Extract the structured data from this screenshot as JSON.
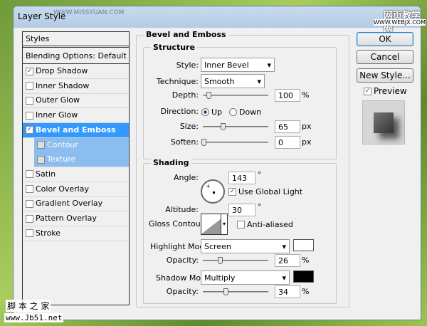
{
  "window": {
    "title": "Layer Style"
  },
  "watermarks": {
    "top_left": "WWW.MISSYUAN.COM",
    "top_right_1": "网页教学网",
    "top_right_2": "WWW.WEBJX.COM",
    "bottom_left_1": "脚 本 之 家",
    "bottom_left_2": "www.Jb51.net"
  },
  "sidebar": {
    "header": "Styles",
    "blending": "Blending Options: Default",
    "items": [
      {
        "label": "Drop Shadow",
        "checked": true
      },
      {
        "label": "Inner Shadow",
        "checked": false
      },
      {
        "label": "Outer Glow",
        "checked": false
      },
      {
        "label": "Inner Glow",
        "checked": false
      },
      {
        "label": "Bevel and Emboss",
        "checked": true,
        "selected": true
      },
      {
        "label": "Contour",
        "checked": false
      },
      {
        "label": "Texture",
        "checked": false
      },
      {
        "label": "Satin",
        "checked": false
      },
      {
        "label": "Color Overlay",
        "checked": false
      },
      {
        "label": "Gradient Overlay",
        "checked": false
      },
      {
        "label": "Pattern Overlay",
        "checked": false
      },
      {
        "label": "Stroke",
        "checked": false
      }
    ]
  },
  "panel": {
    "title": "Bevel and Emboss",
    "structure": {
      "title": "Structure",
      "style_label": "Style:",
      "style": "Inner Bevel",
      "technique_label": "Technique:",
      "technique": "Smooth",
      "depth_label": "Depth:",
      "depth": "100",
      "depth_unit": "%",
      "direction_label": "Direction:",
      "up": "Up",
      "down": "Down",
      "direction": "Up",
      "size_label": "Size:",
      "size": "65",
      "size_unit": "px",
      "soften_label": "Soften:",
      "soften": "0",
      "soften_unit": "px"
    },
    "shading": {
      "title": "Shading",
      "angle_label": "Angle:",
      "angle": "143",
      "deg": "°",
      "global_light": "Use Global Light",
      "global_light_checked": true,
      "altitude_label": "Altitude:",
      "altitude": "30",
      "gloss_label": "Gloss Contour:",
      "anti_aliased": "Anti-aliased",
      "anti_aliased_checked": false,
      "highlight_label": "Highlight Mode:",
      "highlight_mode": "Screen",
      "highlight_color": "#ffffff",
      "opacity_label": "Opacity:",
      "highlight_opacity": "26",
      "pct": "%",
      "shadow_label": "Shadow Mode:",
      "shadow_mode": "Multiply",
      "shadow_color": "#000000",
      "shadow_opacity": "34"
    }
  },
  "buttons": {
    "ok": "OK",
    "cancel": "Cancel",
    "new_style": "New Style...",
    "preview": "Preview",
    "preview_checked": true
  }
}
